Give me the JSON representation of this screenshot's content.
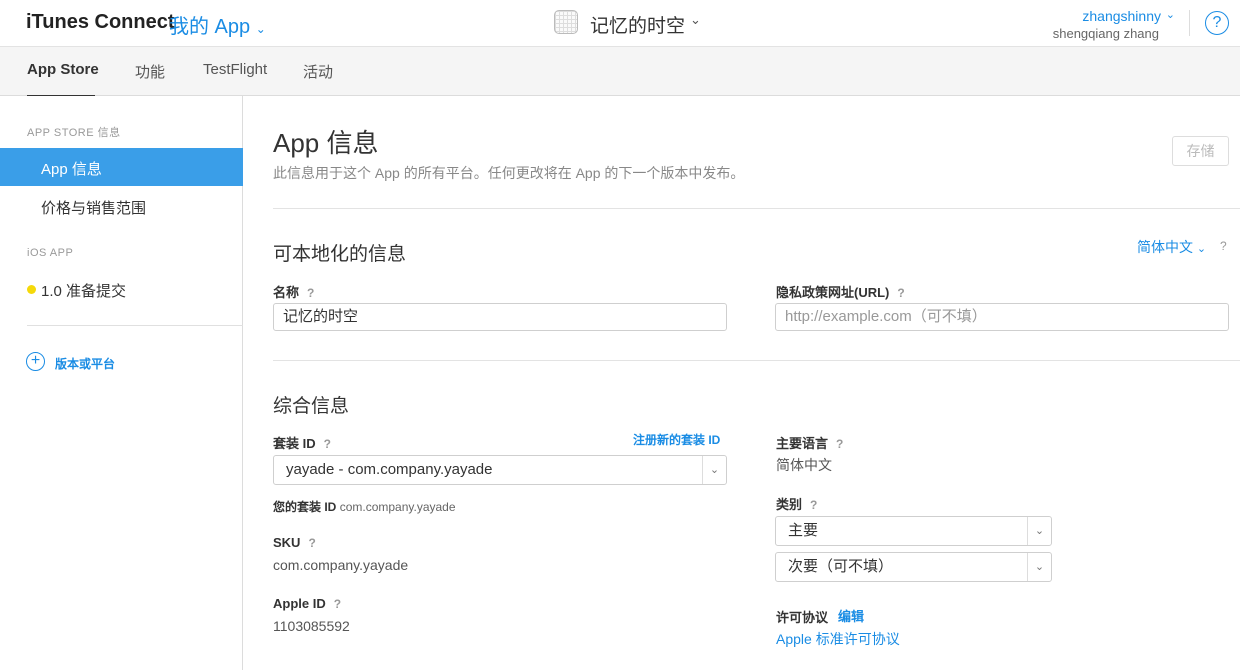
{
  "header": {
    "brand": "iTunes Connect",
    "my_apps": "我的 App",
    "app_name": "记忆的时空",
    "user_name": "zhangshinny",
    "user_full_name": "shengqiang zhang",
    "help": "?"
  },
  "tabs": [
    "App Store",
    "功能",
    "TestFlight",
    "活动"
  ],
  "sidebar": {
    "section1": "APP STORE 信息",
    "items": [
      "App 信息",
      "价格与销售范围"
    ],
    "section2": "iOS APP",
    "version": "1.0 准备提交",
    "add_label": "版本或平台",
    "add_icon": "+"
  },
  "main": {
    "title": "App 信息",
    "subtitle": "此信息用于这个 App 的所有平台。任何更改将在 App 的下一个版本中发布。",
    "save": "存储",
    "localizable": {
      "heading": "可本地化的信息",
      "language": "简体中文",
      "name_label": "名称",
      "name_value": "记忆的时空",
      "privacy_label": "隐私政策网址(URL)",
      "privacy_placeholder": "http://example.com（可不填）"
    },
    "general": {
      "heading": "综合信息",
      "bundle_label": "套装 ID",
      "register_link": "注册新的套装 ID",
      "bundle_value": "yayade - com.company.yayade",
      "your_bundle_label": "您的套装 ID",
      "your_bundle_value": "com.company.yayade",
      "sku_label": "SKU",
      "sku_value": "com.company.yayade",
      "appleid_label": "Apple ID",
      "appleid_value": "1103085592",
      "primary_lang_label": "主要语言",
      "primary_lang_value": "简体中文",
      "category_label": "类别",
      "category_primary": "主要",
      "category_secondary": "次要（可不填）",
      "license_label": "许可协议",
      "license_edit": "编辑",
      "license_link": "Apple 标准许可协议"
    },
    "help_mark": "?"
  },
  "colors": {
    "accent": "#1a8ce4",
    "status_yellow": "#f5d90a",
    "selected_bg": "#3a9ee8"
  }
}
